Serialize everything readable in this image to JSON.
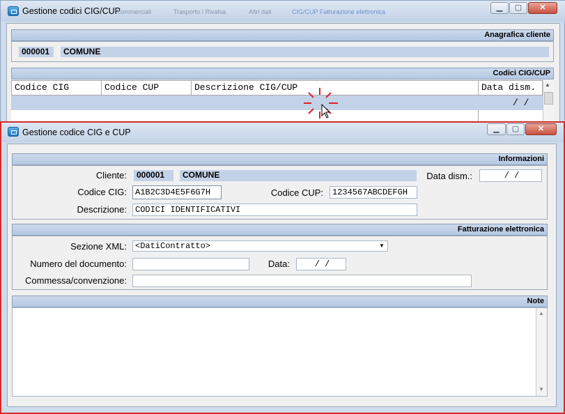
{
  "background_window": {
    "title": "Gestione codici CIG/CUP",
    "ghost_tabs": [
      "commerciali",
      "Trasporto / Rivalsa",
      "Altri dati",
      "CIG/CUP Fatturazione elettronica"
    ],
    "controls": {
      "minimize": "▭",
      "maximize": "▭",
      "close": "✕"
    },
    "anagrafica": {
      "header": "Anagrafica cliente",
      "code": "000001",
      "name": "COMUNE"
    },
    "codici": {
      "header": "Codici CIG/CUP",
      "columns": [
        "Codice CIG",
        "Codice CUP",
        "Descrizione CIG/CUP",
        "Data dism."
      ],
      "row_date": "/  /"
    }
  },
  "dialog": {
    "title": "Gestione codice CIG e CUP",
    "controls": {
      "minimize": "▭",
      "maximize": "▭",
      "close": "✕"
    },
    "informazioni": {
      "header": "Informazioni",
      "cliente_label": "Cliente:",
      "cliente_code": "000001",
      "cliente_name": "COMUNE",
      "data_dism_label": "Data dism.:",
      "data_dism_value": "/  /",
      "cig_label": "Codice CIG:",
      "cig_value": "A1B2C3D4E5F6G7H",
      "cup_label": "Codice CUP:",
      "cup_value": "1234567ABCDEFGH",
      "descrizione_label": "Descrizione:",
      "descrizione_value": "CODICI IDENTIFICATIVI"
    },
    "fatturazione": {
      "header": "Fatturazione elettronica",
      "sezione_label": "Sezione XML:",
      "sezione_value": "<DatiContratto>",
      "numero_label": "Numero del documento:",
      "numero_value": "",
      "data_label": "Data:",
      "data_value": "/  /",
      "commessa_label": "Commessa/convenzione:",
      "commessa_value": ""
    },
    "note": {
      "header": "Note",
      "value": ""
    }
  },
  "colors": {
    "section_bar": "#b5c8e3",
    "highlight": "#c4d2e8",
    "focus_border": "#d52a2a",
    "click_marker": "#e0202a"
  },
  "icons": [
    "window-icon",
    "minimize-icon",
    "maximize-icon",
    "close-icon",
    "dropdown-arrow-icon",
    "scroll-up-icon",
    "scroll-down-icon",
    "mouse-pointer-icon",
    "click-indicator-icon"
  ]
}
